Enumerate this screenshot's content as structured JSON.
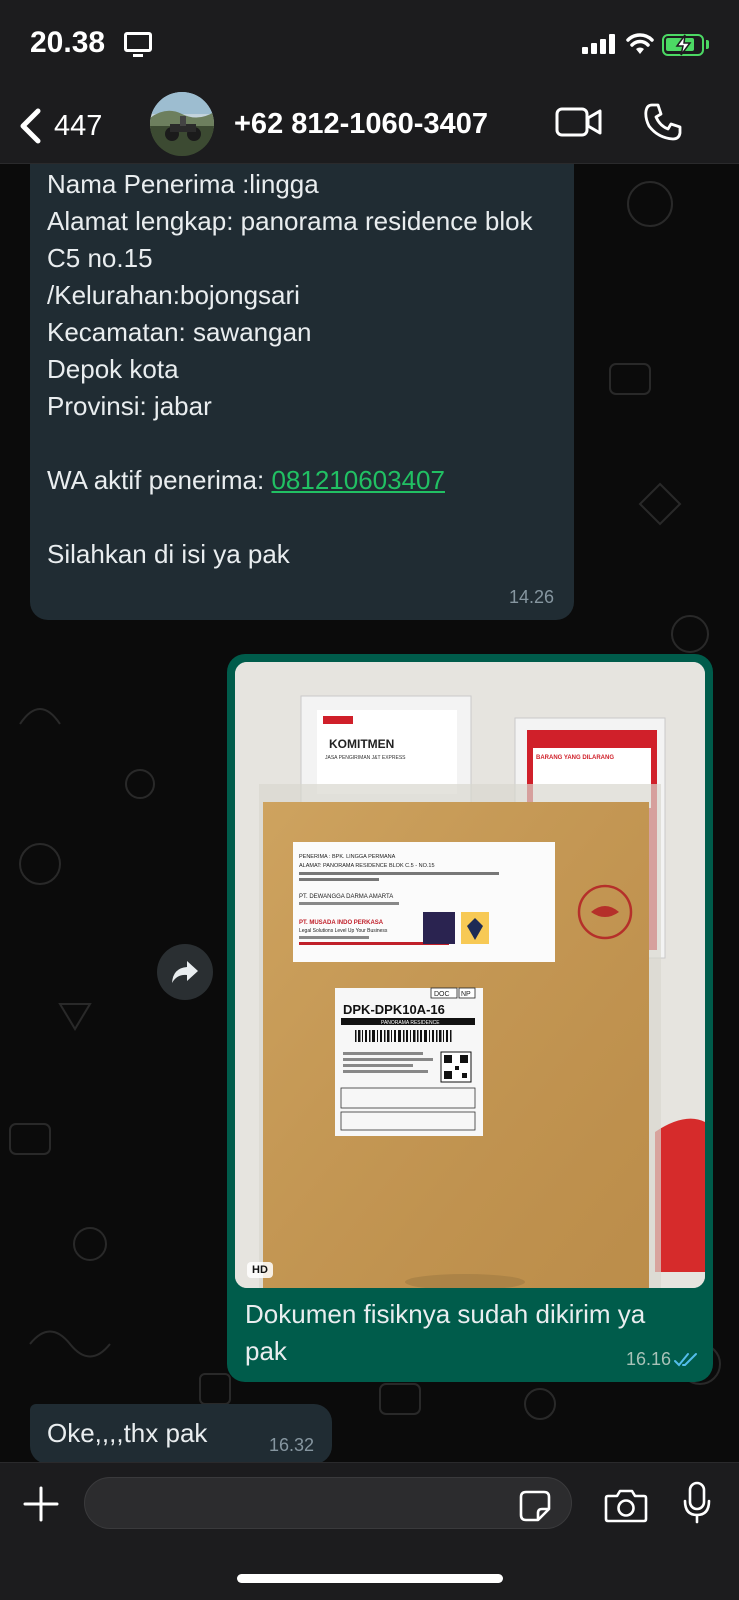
{
  "status_bar": {
    "time": "20.38",
    "screen_icon": "screen-mirroring-icon",
    "battery_color": "#4cd964"
  },
  "header": {
    "back_count": "447",
    "contact_name": "+62 812-1060-3407"
  },
  "messages": [
    {
      "direction": "incoming",
      "text": "Nama Penerima :lingga\nAlamat lengkap: panorama residence blok C5 no.15\n/Kelurahan:bojongsari\nKecamatan: sawangan\nDepok kota\nProvinsi: jabar\n\nWA aktif penerima: ",
      "link": "081210603407",
      "text_after": "\n\nSilahkan di isi ya pak",
      "time": "14.26"
    },
    {
      "direction": "outgoing",
      "image": {
        "hd_badge": "HD",
        "poster_left_title": "KOMITMEN",
        "poster_left_subtitle": "JASA PENGIRIMAN J&T EXPRESS",
        "poster_right_title": "BARANG YANG DILARANG",
        "envelope_label": {
          "recipient": "PENERIMA : BPK. LINGGA PERMANA",
          "address": "ALAMAT: PANORAMA RESIDENCE BLOK C.5 - NO.15",
          "company": "PT. DEWANGGA DARMA AMARTA",
          "sender": "PT. MUSADA INDO PERKASA",
          "tagline": "Legal Solutions Level Up Your Business"
        },
        "waybill": {
          "code": "DPK-DPK10A-16",
          "doc": "DOC",
          "np": "NP",
          "route": "PANORAMA RESIDENCE"
        }
      },
      "caption": "Dokumen fisiknya sudah dikirim ya pak",
      "time": "16.16",
      "read_color": "#53bdeb"
    },
    {
      "direction": "incoming",
      "text": "Oke,,,,thx pak",
      "time": "16.32"
    }
  ],
  "input": {
    "placeholder": ""
  },
  "colors": {
    "incoming_bubble": "#202c33",
    "outgoing_bubble": "#005c4b",
    "link": "#21c063",
    "bar_bg": "#1c1c1e"
  }
}
